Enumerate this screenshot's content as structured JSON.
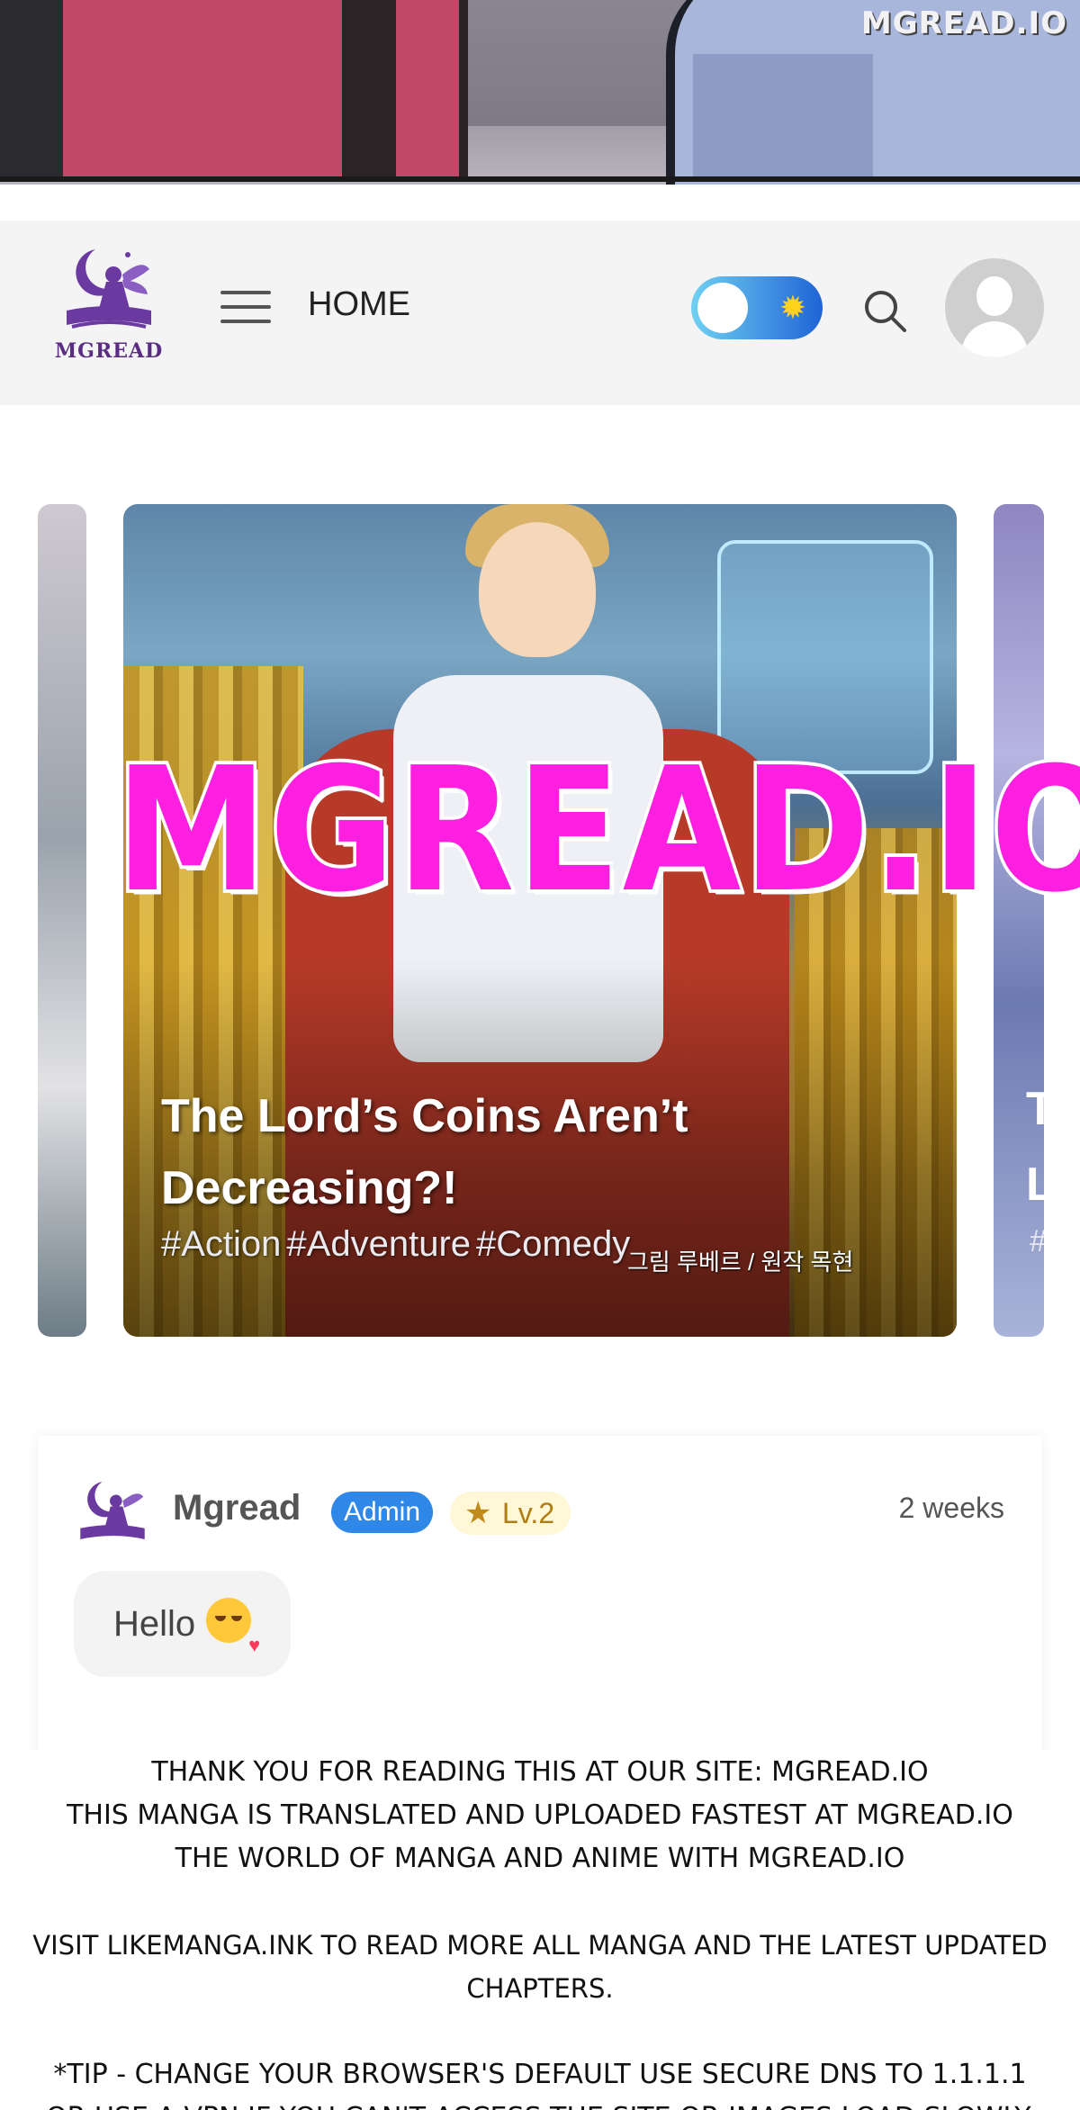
{
  "strip": {
    "watermark": "MGREAD.IO"
  },
  "header": {
    "logo_text": "MGREAD",
    "nav_home": "HOME",
    "theme_toggle": {
      "state": "light",
      "knob_color": "#ffffff",
      "track_colors": [
        "#6fd0f2",
        "#1f64d6"
      ]
    },
    "icons": [
      "fairy-book-logo-icon",
      "hamburger-menu-icon",
      "sun-icon",
      "search-icon",
      "user-avatar-icon"
    ]
  },
  "carousel": {
    "main": {
      "title": "The Lord’s Coins Aren’t Decreasing?!",
      "tags": [
        "#Action",
        "#Adventure",
        "#Comedy"
      ],
      "credit": "그림 루베르 / 원작 목현"
    },
    "right_partial": {
      "title_fragment": "T\nL",
      "tag_fragment": "#"
    }
  },
  "watermark": {
    "text": "MGREAD.IO",
    "fill": "#ff1fe0",
    "stroke": "#ffffff"
  },
  "comment": {
    "user": "Mgread",
    "role_badge": "Admin",
    "level": "Lv.2",
    "time": "2 weeks",
    "message": "Hello",
    "colors": {
      "admin_badge": "#2f87e8",
      "level_badge": "#fff7d6"
    }
  },
  "notice": {
    "line1": "Thank you for reading this at our site: mgread.io",
    "line2": "This manga is translated and uploaded fastest at mgread.io",
    "line3": "The world of manga and anime with mgread.io",
    "line4": "Visit likemanga.ink to read more all manga and the latest updated chapters.",
    "line5": "*Tip - change your browser's default use secure DNS to 1.1.1.1",
    "line6": "or use a VPN if you can't access the site or images load slowly."
  }
}
